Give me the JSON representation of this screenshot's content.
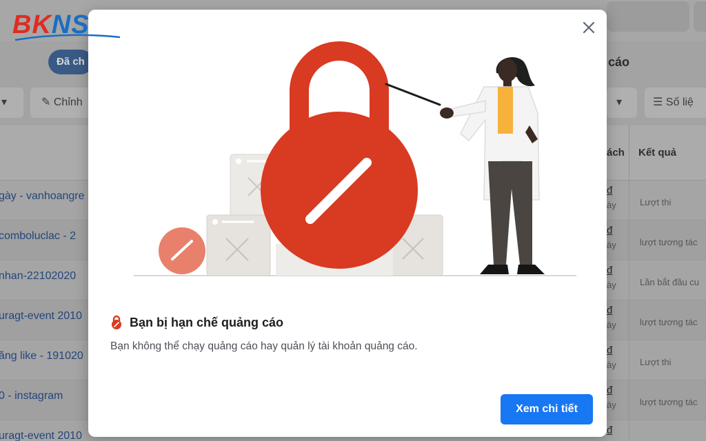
{
  "brand": {
    "logo_text_a": "BK",
    "logo_text_b": "NS"
  },
  "background": {
    "filter_pill": "Đã ch",
    "section_title": "g cáo",
    "toolbar": {
      "edit": "Chỉnh",
      "metrics": "Số liệ"
    },
    "columns": {
      "spend": "ách",
      "result": "Kết quả"
    },
    "rows": [
      {
        "name": "gày - vanhoangre",
        "money": "đ",
        "money_sub": "ày",
        "result": "Lượt thi"
      },
      {
        "name": "comboluclac - 2",
        "money": "đ",
        "money_sub": "ày",
        "result": "lượt tương tác"
      },
      {
        "name": "nhan-22102020",
        "money": "đ",
        "money_sub": "ày",
        "result": "Lần bắt đầu cu"
      },
      {
        "name": "uragt-event 2010",
        "money": "đ",
        "money_sub": "ày",
        "result": "lượt tương tác"
      },
      {
        "name": "ăng like - 191020",
        "money": "đ",
        "money_sub": "ày",
        "result": "Lượt thi"
      },
      {
        "name": "0 - instagram",
        "money": "đ",
        "money_sub": "ày",
        "result": "lượt tương tác"
      },
      {
        "name": "uragt-event 2010",
        "money": "đ",
        "money_sub": "",
        "result": ""
      }
    ]
  },
  "modal": {
    "title": "Bạn bị hạn chế quảng cáo",
    "description": "Bạn không thể chạy quảng cáo hay quản lý tài khoản quảng cáo.",
    "cta_label": "Xem chi tiết",
    "colors": {
      "accent": "#1877f2",
      "lock_red": "#d93a22",
      "badge_red": "#e8806c"
    }
  }
}
